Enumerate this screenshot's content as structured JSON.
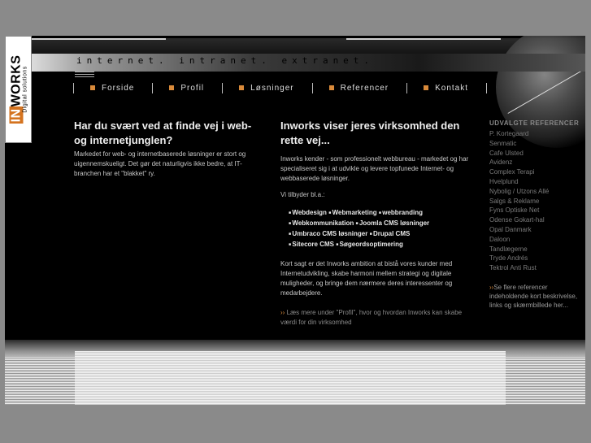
{
  "logo": {
    "brand_prefix": "IN",
    "brand_suffix": "WORKS",
    "subtitle": "Digital solutions"
  },
  "tagline": "internet. intranet. extranet.",
  "nav": [
    {
      "label": "Forside"
    },
    {
      "label": "Profil"
    },
    {
      "label": "Løsninger"
    },
    {
      "label": "Referencer"
    },
    {
      "label": "Kontakt"
    }
  ],
  "colors": {
    "accent": "#d98a3a",
    "background": "#000000",
    "frame": "#8a8a8a"
  },
  "left": {
    "heading": "Har du svært ved at finde vej i web- og internetjunglen?",
    "text": "Markedet for web- og internetbaserede løsninger er stort og uigennemskueligt. Det gør det naturligvis ikke bedre, at IT-branchen har et \"blakket\" ry."
  },
  "middle": {
    "heading": "Inworks viser jeres virksomhed den rette vej...",
    "intro": "Inworks kender - som professionelt webbureau - markedet og har specialiseret sig i at udvikle og levere topfunede Internet- og webbaserede løsninger.",
    "offer_label": "Vi tilbyder bl.a.:",
    "bullet_rows": [
      [
        "Webdesign",
        "Webmarketing",
        "webbranding"
      ],
      [
        "Webkommunikation",
        "Joomla CMS løsninger"
      ],
      [
        "Umbraco CMS løsninger",
        "Drupal CMS"
      ],
      [
        "Sitecore CMS",
        "Søgeordsoptimering"
      ]
    ],
    "ambition": "Kort sagt er det Inworks ambition at bistå vores kunder med Internetudvikling, skabe harmoni mellem strategi og digitale muligheder, og bringe dem nærmere deres interessenter og medarbejdere.",
    "readmore": "Læs mere under \"Profil\", hvor og hvordan Inworks kan skabe værdi for din virksomhed"
  },
  "sidebar": {
    "heading": "UDVALGTE REFERENCER",
    "items": [
      "P. Kortegaard",
      "Senmatic",
      "Cafe Ulsted",
      "Avidenz",
      "Complex Terapi",
      "Hvelplund",
      "Nybolig / Utzons Allé",
      "Salgs & Reklame",
      "Fyns Optiske Net",
      "Odense Gokart-hal",
      "Opal Danmark",
      "Daloon",
      "Tandlægerne",
      "Tryde Andrés",
      "Tektrol Anti Rust"
    ],
    "more_link": "Se flere referencer",
    "more_text": "indeholdende kort beskrivelse, links og skærmbillede her..."
  }
}
